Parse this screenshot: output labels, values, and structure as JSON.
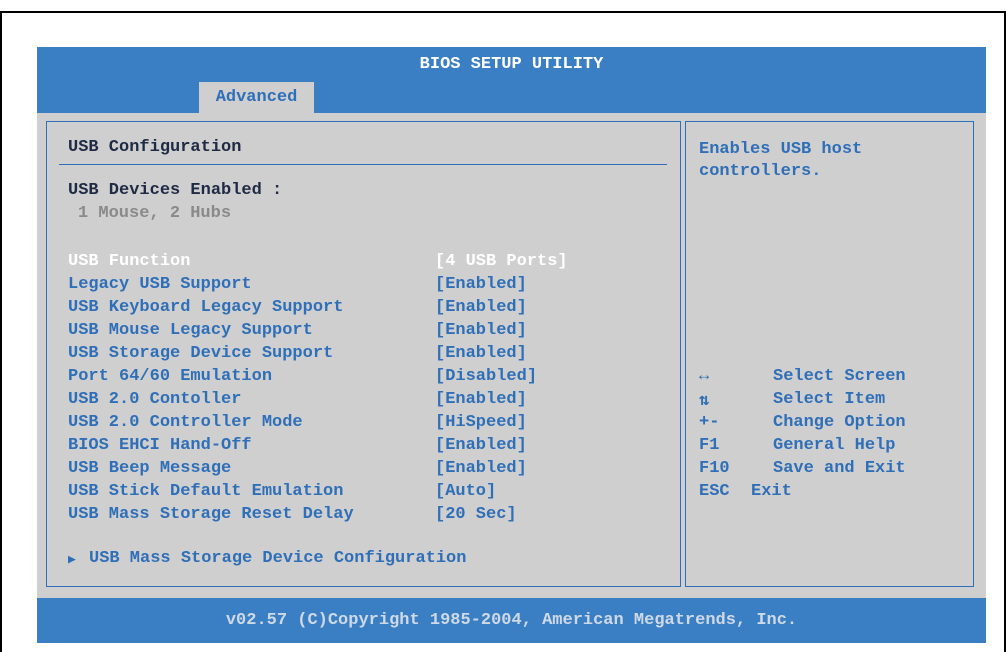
{
  "title": "BIOS SETUP UTILITY",
  "tab": "Advanced",
  "section": {
    "heading": "USB Configuration",
    "devices_label": "USB Devices Enabled :",
    "devices_value": "1 Mouse, 2 Hubs"
  },
  "options": [
    {
      "label": "USB Function",
      "value": "[4 USB Ports]"
    },
    {
      "label": "Legacy USB Support",
      "value": "[Enabled]"
    },
    {
      "label": "USB Keyboard Legacy Support",
      "value": "[Enabled]"
    },
    {
      "label": "USB Mouse Legacy Support",
      "value": "[Enabled]"
    },
    {
      "label": "USB Storage Device Support",
      "value": "[Enabled]"
    },
    {
      "label": "Port 64/60 Emulation",
      "value": "[Disabled]"
    },
    {
      "label": "USB 2.0 Contoller",
      "value": "[Enabled]"
    },
    {
      "label": "USB 2.0 Controller Mode",
      "value": "[HiSpeed]"
    },
    {
      "label": "BIOS EHCI Hand-Off",
      "value": "[Enabled]"
    },
    {
      "label": "USB Beep Message",
      "value": "[Enabled]"
    },
    {
      "label": "USB Stick Default Emulation",
      "value": "[Auto]"
    },
    {
      "label": "USB Mass Storage Reset Delay",
      "value": "[20 Sec]"
    }
  ],
  "submenu": {
    "arrow": "▶",
    "label": "USB Mass Storage Device Configuration"
  },
  "help": {
    "line1": "Enables USB host",
    "line2": "controllers."
  },
  "keys": [
    {
      "key": "↔",
      "action": "Select Screen"
    },
    {
      "key": "⇅",
      "action": "Select Item"
    },
    {
      "key": "+-",
      "action": "Change Option"
    },
    {
      "key": "F1",
      "action": "General Help"
    },
    {
      "key": "F10",
      "action": "Save and Exit"
    },
    {
      "key": "ESC",
      "action": "Exit"
    }
  ],
  "footer": "v02.57 (C)Copyright 1985-2004, American Megatrends, Inc.",
  "colors": {
    "bios_blue": "#3a7fc4",
    "panel_gray": "#cfcfcf",
    "text_dark": "#1f2a44",
    "text_blue": "#2f6fb8",
    "selected": "#ffffff"
  }
}
